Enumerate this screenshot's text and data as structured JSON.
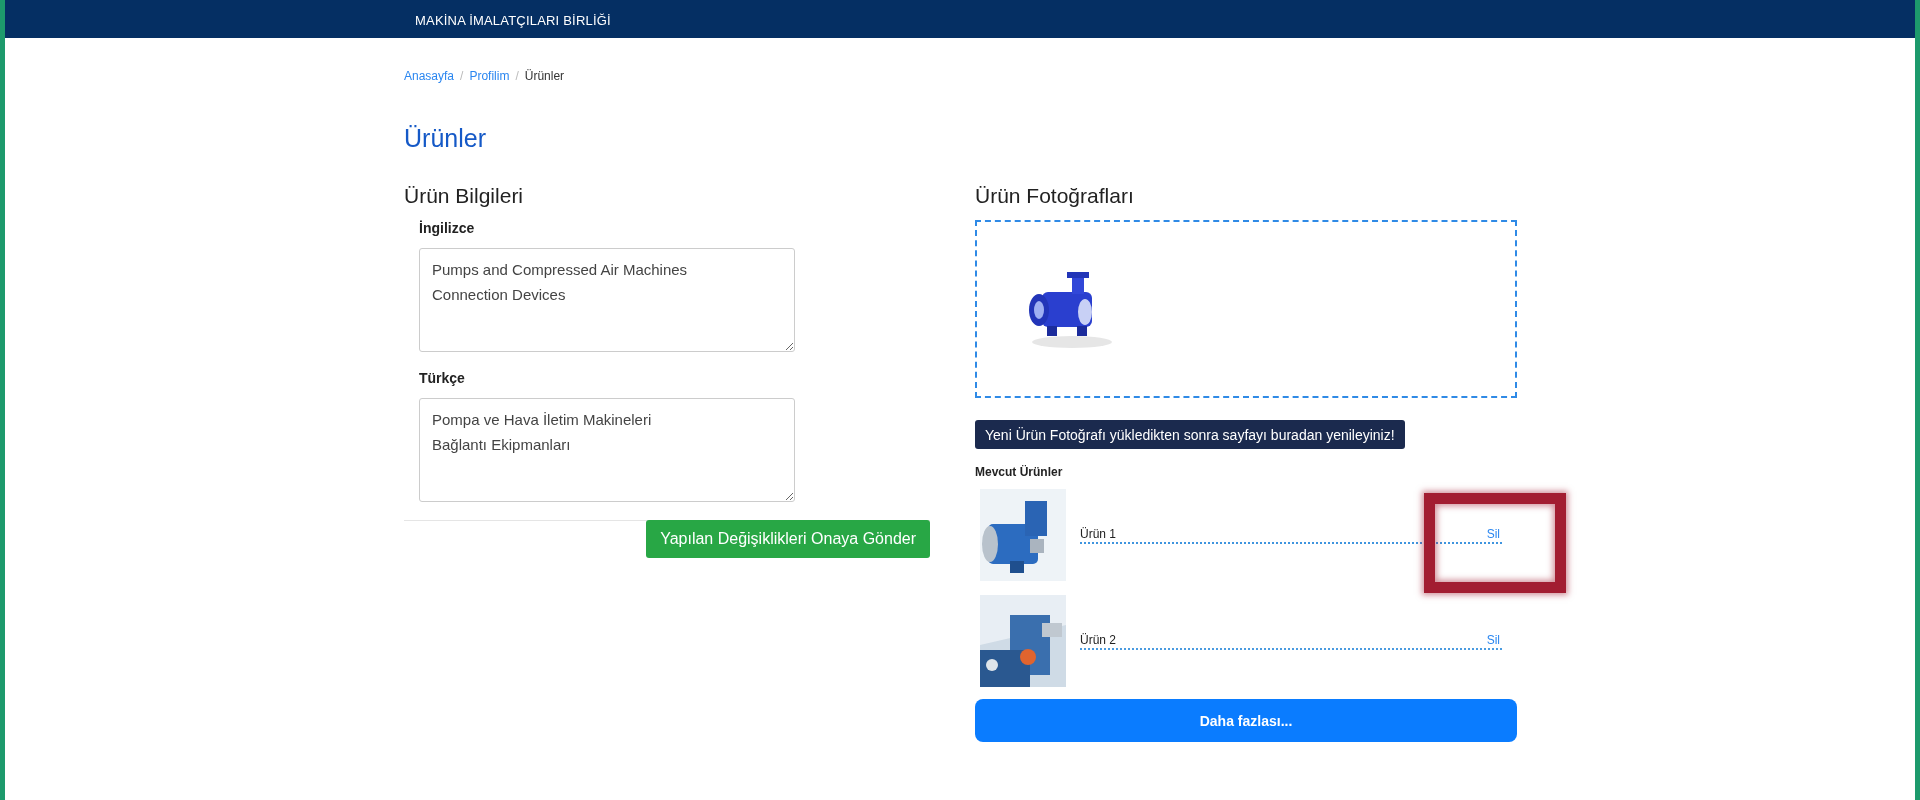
{
  "header": {
    "org_name": "MAKİNA İMALATÇILARI BİRLİĞİ"
  },
  "breadcrumb_separator": "/",
  "breadcrumb": [
    {
      "label": "Anasayfa",
      "kind": "link"
    },
    {
      "label": "Profilim",
      "kind": "link"
    },
    {
      "label": "Ürünler",
      "kind": "current"
    }
  ],
  "page_title": "Ürünler",
  "info": {
    "title": "Ürün Bilgileri",
    "fields": [
      {
        "label": "İngilizce",
        "value": "Pumps and Compressed Air Machines\nConnection Devices"
      },
      {
        "label": "Türkçe",
        "value": "Pompa ve Hava İletim Makineleri\nBağlantı Ekipmanları"
      }
    ],
    "submit": "Yapılan Değişiklikleri Onaya Gönder"
  },
  "photos": {
    "title": "Ürün Fotoğrafları",
    "refresh": "Yeni Ürün Fotoğrafı yükledikten sonra sayfayı buradan yenileyiniz!",
    "list_title": "Mevcut Ürünler",
    "products": [
      {
        "name": "Ürün 1",
        "action": "Sil",
        "highlighted": true
      },
      {
        "name": "Ürün 2",
        "action": "Sil",
        "highlighted": false
      }
    ],
    "more": "Daha fazlası..."
  }
}
